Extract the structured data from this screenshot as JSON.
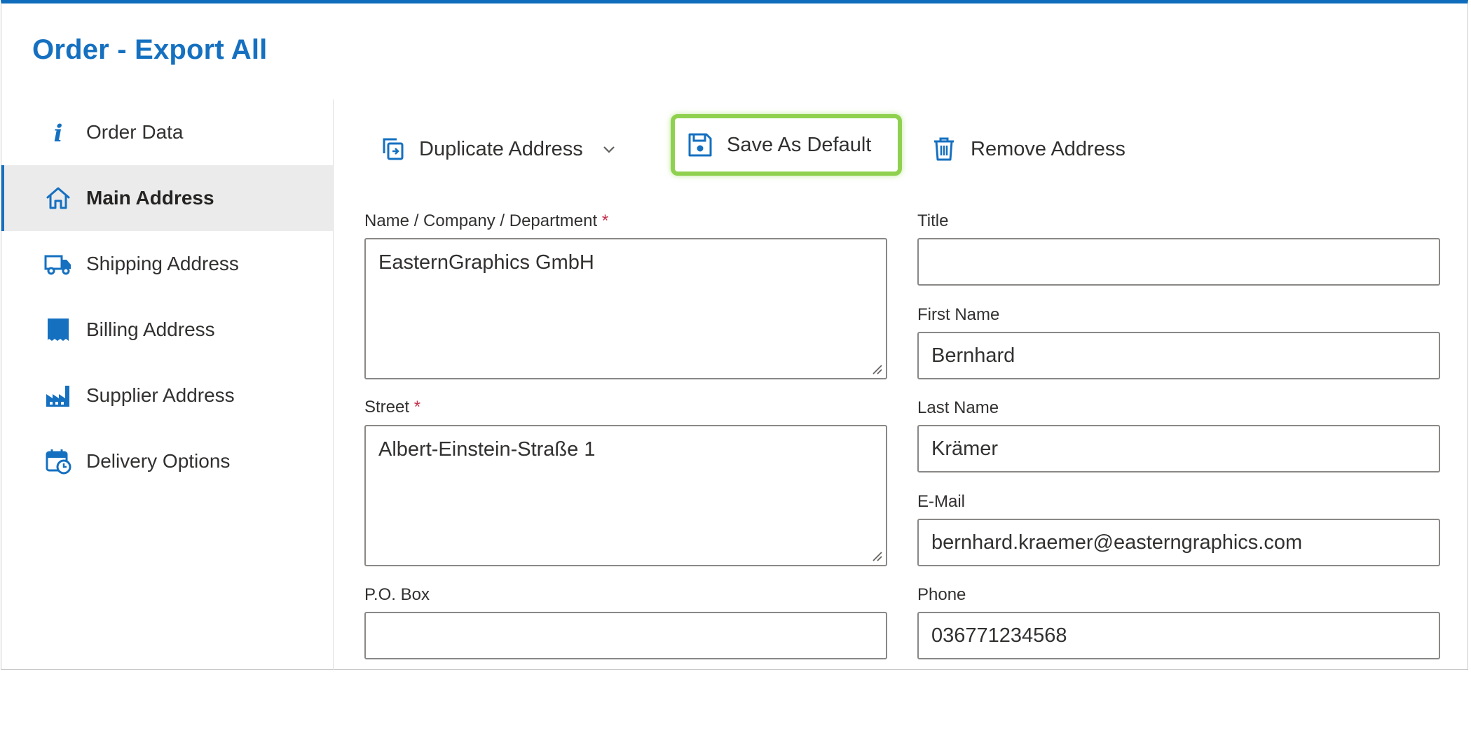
{
  "page": {
    "title": "Order - Export All"
  },
  "sidebar": {
    "items": [
      {
        "label": "Order Data",
        "icon": "info-icon",
        "active": false
      },
      {
        "label": "Main Address",
        "icon": "home-icon",
        "active": true
      },
      {
        "label": "Shipping Address",
        "icon": "truck-icon",
        "active": false
      },
      {
        "label": "Billing Address",
        "icon": "billing-icon",
        "active": false
      },
      {
        "label": "Supplier Address",
        "icon": "factory-icon",
        "active": false
      },
      {
        "label": "Delivery Options",
        "icon": "calendar-clock-icon",
        "active": false
      }
    ]
  },
  "toolbar": {
    "duplicate_label": "Duplicate Address",
    "save_default_label": "Save As Default",
    "remove_label": "Remove Address"
  },
  "form": {
    "name": {
      "label": "Name / Company / Department",
      "required_mark": "*",
      "value": "EasternGraphics GmbH"
    },
    "street": {
      "label": "Street",
      "required_mark": "*",
      "value": "Albert-Einstein-Straße 1"
    },
    "po_box": {
      "label": "P.O. Box",
      "value": ""
    },
    "title": {
      "label": "Title",
      "value": ""
    },
    "first_name": {
      "label": "First Name",
      "value": "Bernhard"
    },
    "last_name": {
      "label": "Last Name",
      "value": "Krämer"
    },
    "email": {
      "label": "E-Mail",
      "value": "bernhard.kraemer@easterngraphics.com"
    },
    "phone": {
      "label": "Phone",
      "value": "036771234568"
    }
  },
  "colors": {
    "accent": "#1570c0",
    "highlight": "#8fd14f",
    "required": "#c4314b",
    "active_nav_bg": "#ebebeb"
  }
}
